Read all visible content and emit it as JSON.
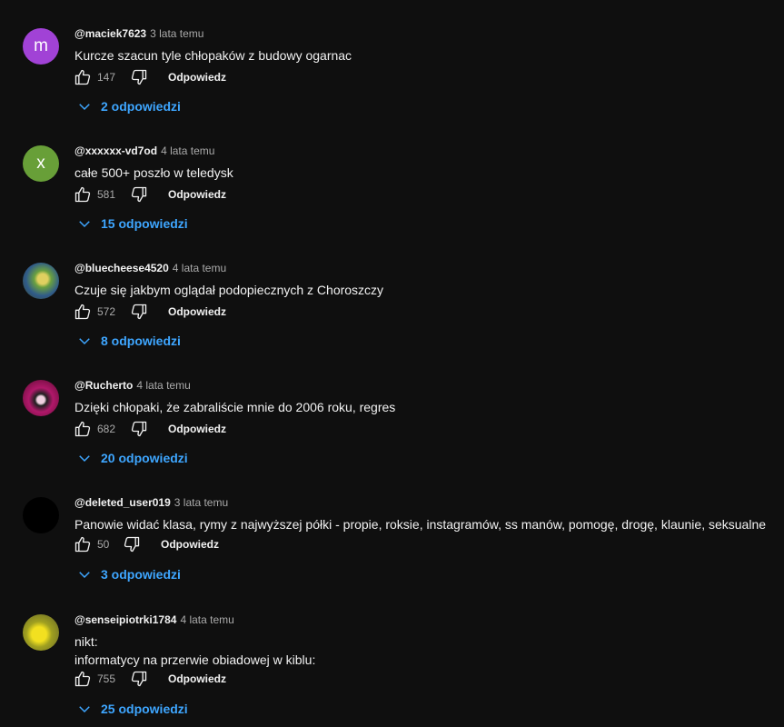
{
  "comments": [
    {
      "author": "@maciek7623",
      "time": "3 lata temu",
      "text": "Kurcze szacun tyle chłopaków z budowy ogarnac",
      "likes": "147",
      "reply_label": "Odpowiedz",
      "replies": "2 odpowiedzi",
      "avatar_letter": "m",
      "avatar_color": "#a142d6"
    },
    {
      "author": "@xxxxxx-vd7od",
      "time": "4 lata temu",
      "text": "całe 500+ poszło w teledysk",
      "likes": "581",
      "reply_label": "Odpowiedz",
      "replies": "15 odpowiedzi",
      "avatar_letter": "x",
      "avatar_color": "#689f38"
    },
    {
      "author": "@bluecheese4520",
      "time": "4 lata temu",
      "text": "Czuje się jakbym oglądał podopiecznych z Choroszczy",
      "likes": "572",
      "reply_label": "Odpowiedz",
      "replies": "8 odpowiedzi",
      "avatar_letter": "",
      "avatar_color": "#4d6b3a"
    },
    {
      "author": "@Rucherto",
      "time": "4 lata temu",
      "text": "Dzięki chłopaki, że zabraliście mnie do 2006 roku, regres",
      "likes": "682",
      "reply_label": "Odpowiedz",
      "replies": "20 odpowiedzi",
      "avatar_letter": "",
      "avatar_color": "#b0186a"
    },
    {
      "author": "@deleted_user019",
      "time": "3 lata temu",
      "text": "Panowie widać klasa, rymy z najwyższej półki - propie, roksie, instagramów, ss manów, pomogę, drogę, klaunie, seksualne",
      "likes": "50",
      "reply_label": "Odpowiedz",
      "replies": "3 odpowiedzi",
      "avatar_letter": "",
      "avatar_color": "#000000"
    },
    {
      "author": "@senseipiotrki1784",
      "time": "4 lata temu",
      "text": "nikt:\ninformatycy na przerwie obiadowej w kiblu:",
      "likes": "755",
      "reply_label": "Odpowiedz",
      "replies": "25 odpowiedzi",
      "avatar_letter": "",
      "avatar_color": "#8a8a20"
    }
  ]
}
